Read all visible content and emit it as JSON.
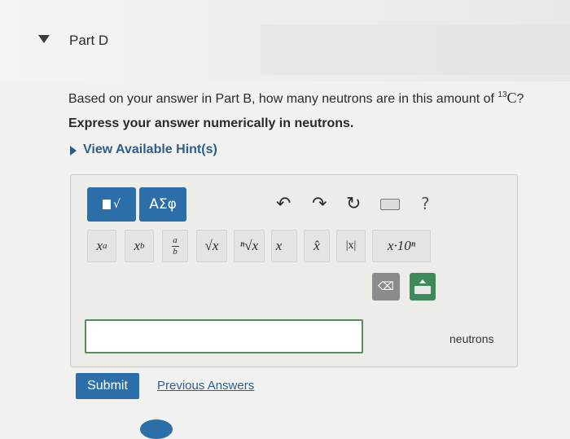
{
  "part": {
    "title": "Part D"
  },
  "question": {
    "text": "Based on your answer in Part B, how many neutrons are in this amount of",
    "isotope_mass": "13",
    "isotope_symbol": "C",
    "end": "?"
  },
  "instruction": "Express your answer numerically in neutrons.",
  "hints": {
    "label": "View Available Hint(s)"
  },
  "toolbar": {
    "template_label": "√",
    "greek_label": "ΑΣφ",
    "undo_icon": "undo-arrow",
    "redo_icon": "redo-arrow",
    "reset_icon": "reset-circle-arrow",
    "keyboard_icon": "keyboard",
    "help_label": "?"
  },
  "math_buttons": [
    {
      "name": "superscript",
      "base": "x",
      "sup": "a"
    },
    {
      "name": "subscript",
      "base": "x",
      "sub": "b"
    },
    {
      "name": "fraction",
      "num": "a",
      "den": "b"
    },
    {
      "name": "square-root",
      "label": "√x"
    },
    {
      "name": "nth-root",
      "label": "ⁿ√x"
    },
    {
      "name": "vector",
      "label": "x⃗"
    },
    {
      "name": "unit-vector",
      "label": "x̂"
    },
    {
      "name": "absolute-value",
      "label": "|x|"
    },
    {
      "name": "scientific-notation",
      "label": "x·10ⁿ"
    }
  ],
  "answer": {
    "value": "",
    "units": "neutrons"
  },
  "actions": {
    "submit": "Submit",
    "previous": "Previous Answers"
  }
}
